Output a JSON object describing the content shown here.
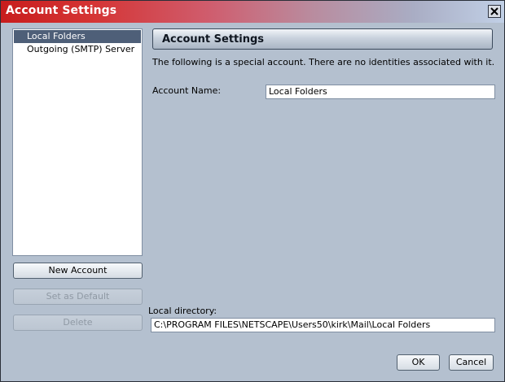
{
  "window": {
    "title": "Account Settings"
  },
  "accounts": [
    {
      "label": "Local Folders",
      "selected": true
    },
    {
      "label": "Outgoing (SMTP) Server",
      "selected": false
    }
  ],
  "buttons": {
    "new_account": "New Account",
    "set_default": "Set as Default",
    "delete": "Delete",
    "ok": "OK",
    "cancel": "Cancel"
  },
  "panel": {
    "title": "Account Settings",
    "description": "The following is a special account. There are no identities associated with it.",
    "account_name_label": "Account Name:",
    "account_name_value": "Local Folders",
    "local_directory_label": "Local directory:",
    "local_directory_value": "C:\\PROGRAM FILES\\NETSCAPE\\Users50\\kirk\\Mail\\Local Folders"
  },
  "colors": {
    "selection": "#4e5f78",
    "background": "#b4c0cf",
    "titlebar_start": "#c81d1d"
  },
  "icons": {
    "close": "close-icon"
  }
}
